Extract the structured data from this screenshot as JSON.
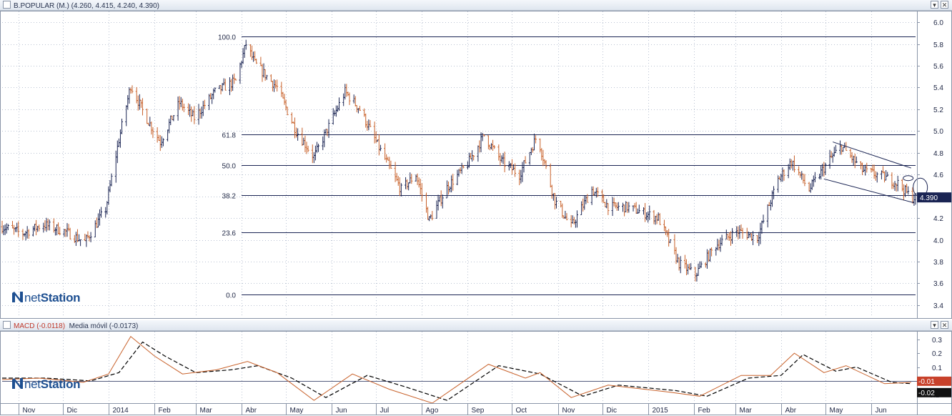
{
  "windows": {
    "price": {
      "title": "B.POPULAR (M.) (4.260, 4.415, 4.240, 4.390)"
    },
    "macd": {
      "title_a": "MACD (-0.0118)",
      "title_b": "Media móvil (-0.0173)"
    }
  },
  "logo": {
    "text_a": "net",
    "text_b": "Station"
  },
  "colors": {
    "up": "#1a2453",
    "down": "#c8612a",
    "grid": "#b9c2d2",
    "line": "#1a2453",
    "macd": "#c8612a",
    "signal": "#000000",
    "tag_price": "#1a2453",
    "tag_macd": "#c8412a"
  },
  "chart_data": [
    {
      "type": "candlestick",
      "name": "B.POPULAR",
      "y_axis": {
        "ticks": [
          "6.0",
          "5.8",
          "5.6",
          "5.4",
          "5.2",
          "5.0",
          "4.8",
          "4.6",
          "4.4",
          "4.2",
          "4.0",
          "3.8",
          "3.6",
          "3.4"
        ],
        "ylim": [
          3.3,
          6.1
        ]
      },
      "x_axis": {
        "ticks": [
          "Nov",
          "Dic",
          "2014",
          "Feb",
          "Mar",
          "Abr",
          "May",
          "Jun",
          "Jul",
          "Ago",
          "Sep",
          "Oct",
          "Nov",
          "Dic",
          "2015",
          "Feb",
          "Mar",
          "Abr",
          "May",
          "Jun"
        ],
        "range": [
          "2013-10-21",
          "2015-07-01"
        ]
      },
      "last_close": 4.39,
      "last_label": "4.390",
      "ohlc_last": {
        "open": 4.26,
        "high": 4.415,
        "low": 4.24,
        "close": 4.39
      },
      "price_path": [
        [
          "2013-10-21",
          4.12
        ],
        [
          "2013-11-04",
          4.06
        ],
        [
          "2013-11-18",
          4.14
        ],
        [
          "2013-12-02",
          4.08
        ],
        [
          "2013-12-16",
          3.98
        ],
        [
          "2013-12-30",
          4.28
        ],
        [
          "2014-01-08",
          4.92
        ],
        [
          "2014-01-16",
          5.42
        ],
        [
          "2014-01-25",
          5.16
        ],
        [
          "2014-02-05",
          4.9
        ],
        [
          "2014-02-18",
          5.26
        ],
        [
          "2014-02-28",
          5.12
        ],
        [
          "2014-03-14",
          5.36
        ],
        [
          "2014-03-28",
          5.46
        ],
        [
          "2014-04-04",
          5.8
        ],
        [
          "2014-04-10",
          5.62
        ],
        [
          "2014-04-25",
          5.4
        ],
        [
          "2014-05-08",
          5.0
        ],
        [
          "2014-05-20",
          4.76
        ],
        [
          "2014-06-01",
          5.1
        ],
        [
          "2014-06-10",
          5.36
        ],
        [
          "2014-06-20",
          5.2
        ],
        [
          "2014-07-04",
          4.82
        ],
        [
          "2014-07-18",
          4.46
        ],
        [
          "2014-07-28",
          4.6
        ],
        [
          "2014-08-06",
          4.18
        ],
        [
          "2014-08-18",
          4.48
        ],
        [
          "2014-09-01",
          4.7
        ],
        [
          "2014-09-12",
          4.96
        ],
        [
          "2014-09-24",
          4.72
        ],
        [
          "2014-10-06",
          4.6
        ],
        [
          "2014-10-18",
          4.96
        ],
        [
          "2014-10-30",
          4.36
        ],
        [
          "2014-11-10",
          4.12
        ],
        [
          "2014-11-24",
          4.46
        ],
        [
          "2014-12-06",
          4.3
        ],
        [
          "2014-12-18",
          4.3
        ],
        [
          "2015-01-08",
          4.2
        ],
        [
          "2015-01-22",
          3.78
        ],
        [
          "2015-02-02",
          3.68
        ],
        [
          "2015-02-16",
          3.95
        ],
        [
          "2015-03-02",
          4.08
        ],
        [
          "2015-03-16",
          4.02
        ],
        [
          "2015-03-30",
          4.55
        ],
        [
          "2015-04-08",
          4.72
        ],
        [
          "2015-04-20",
          4.46
        ],
        [
          "2015-05-04",
          4.74
        ],
        [
          "2015-05-12",
          4.86
        ],
        [
          "2015-05-26",
          4.64
        ],
        [
          "2015-06-09",
          4.58
        ],
        [
          "2015-06-19",
          4.52
        ],
        [
          "2015-06-28",
          4.39
        ]
      ],
      "fibonacci": [
        {
          "label": "100.0",
          "value": 5.87
        },
        {
          "label": "61.8",
          "value": 4.97
        },
        {
          "label": "50.0",
          "value": 4.69
        },
        {
          "label": "38.2",
          "value": 4.41
        },
        {
          "label": "23.6",
          "value": 4.07
        },
        {
          "label": "0.0",
          "value": 3.5
        }
      ],
      "trend_channel": {
        "upper": [
          [
            "2015-05-06",
            4.9
          ],
          [
            "2015-06-28",
            4.66
          ]
        ],
        "lower": [
          [
            "2015-04-30",
            4.56
          ],
          [
            "2015-06-30",
            4.34
          ]
        ]
      },
      "marker": {
        "date": "2015-06-26",
        "value": 4.58,
        "shape": "ellipse"
      }
    },
    {
      "type": "line",
      "name": "MACD",
      "y_axis": {
        "ticks": [
          "0.3",
          "0.2",
          "0.1",
          "0.0",
          "-0.1"
        ],
        "ylim": [
          -0.16,
          0.36
        ]
      },
      "series": [
        {
          "name": "MACD",
          "values": [
            [
              "2013-10-21",
              0.01
            ],
            [
              "2013-11-15",
              0.02
            ],
            [
              "2013-12-15",
              -0.01
            ],
            [
              "2014-01-01",
              0.05
            ],
            [
              "2014-01-16",
              0.32
            ],
            [
              "2014-02-01",
              0.18
            ],
            [
              "2014-02-20",
              0.05
            ],
            [
              "2014-03-15",
              0.08
            ],
            [
              "2014-04-05",
              0.14
            ],
            [
              "2014-04-25",
              0.06
            ],
            [
              "2014-05-20",
              -0.14
            ],
            [
              "2014-06-15",
              0.05
            ],
            [
              "2014-07-10",
              -0.06
            ],
            [
              "2014-08-08",
              -0.16
            ],
            [
              "2014-09-15",
              0.12
            ],
            [
              "2014-10-10",
              0.02
            ],
            [
              "2014-10-20",
              0.06
            ],
            [
              "2014-11-10",
              -0.12
            ],
            [
              "2014-12-05",
              -0.03
            ],
            [
              "2015-01-15",
              -0.08
            ],
            [
              "2015-02-05",
              -0.11
            ],
            [
              "2015-03-05",
              0.04
            ],
            [
              "2015-03-25",
              0.04
            ],
            [
              "2015-04-10",
              0.2
            ],
            [
              "2015-04-30",
              0.06
            ],
            [
              "2015-05-15",
              0.11
            ],
            [
              "2015-06-10",
              -0.02
            ],
            [
              "2015-06-28",
              -0.01
            ]
          ]
        },
        {
          "name": "Media móvil",
          "values": [
            [
              "2013-10-21",
              0.02
            ],
            [
              "2013-11-20",
              0.02
            ],
            [
              "2013-12-20",
              0.0
            ],
            [
              "2014-01-08",
              0.06
            ],
            [
              "2014-01-24",
              0.28
            ],
            [
              "2014-02-08",
              0.18
            ],
            [
              "2014-03-01",
              0.06
            ],
            [
              "2014-03-25",
              0.08
            ],
            [
              "2014-04-12",
              0.11
            ],
            [
              "2014-05-05",
              0.02
            ],
            [
              "2014-05-28",
              -0.12
            ],
            [
              "2014-06-25",
              0.04
            ],
            [
              "2014-07-20",
              -0.04
            ],
            [
              "2014-08-18",
              -0.14
            ],
            [
              "2014-09-22",
              0.11
            ],
            [
              "2014-10-20",
              0.05
            ],
            [
              "2014-11-18",
              -0.11
            ],
            [
              "2014-12-12",
              -0.03
            ],
            [
              "2015-01-20",
              -0.07
            ],
            [
              "2015-02-10",
              -0.11
            ],
            [
              "2015-03-10",
              0.02
            ],
            [
              "2015-04-01",
              0.04
            ],
            [
              "2015-04-16",
              0.19
            ],
            [
              "2015-05-08",
              0.07
            ],
            [
              "2015-05-22",
              0.1
            ],
            [
              "2015-06-15",
              -0.01
            ],
            [
              "2015-06-28",
              -0.02
            ]
          ]
        }
      ],
      "labels": {
        "macd": "-0.01",
        "signal": "-0.02"
      }
    }
  ]
}
